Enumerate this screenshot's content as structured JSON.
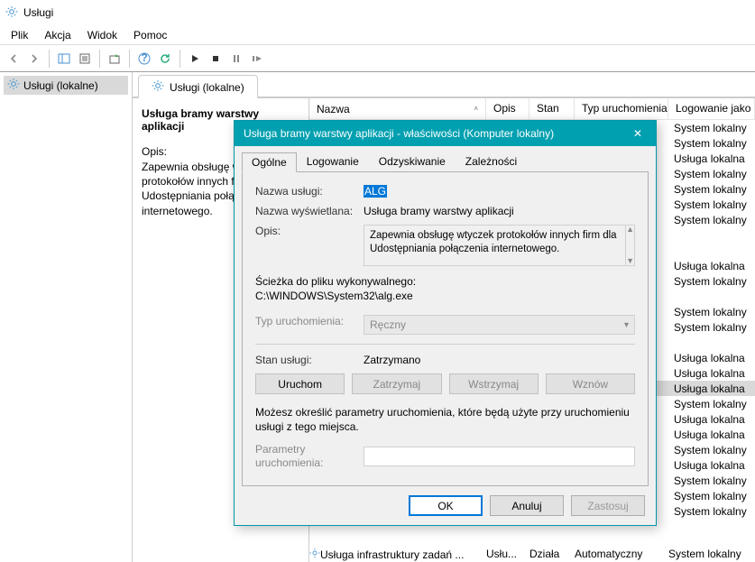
{
  "window": {
    "title": "Usługi"
  },
  "menu": {
    "file": "Plik",
    "action": "Akcja",
    "view": "Widok",
    "help": "Pomoc"
  },
  "tree": {
    "root": "Usługi (lokalne)"
  },
  "tab": {
    "label": "Usługi (lokalne)"
  },
  "detail": {
    "title": "Usługa bramy warstwy aplikacji",
    "opis_label": "Opis:",
    "opis_text": "Zapewnia obsługę wtyczek protokołów innych firm dla Udostępniania połączenia internetowego."
  },
  "columns": {
    "name": "Nazwa",
    "opis": "Opis",
    "stan": "Stan",
    "typ": "Typ uruchomienia",
    "log": "Logowanie jako"
  },
  "rows": {
    "status_dziala": "Działa",
    "log_system": "System lokalny",
    "log_usluga": "Usługa lokalna",
    "typ_auto": "Automatyczny",
    "ellipsis": "...",
    "footer_name": "Usługa infrastruktury zadań ...",
    "footer_opis": "Usłu...",
    "logs": [
      "System lokalny",
      "System lokalny",
      "Usługa lokalna",
      "System lokalny",
      "System lokalny",
      "System lokalny",
      "System lokalny",
      "",
      "",
      "Usługa lokalna",
      "System lokalny",
      "",
      "System lokalny",
      "System lokalny",
      "",
      "Usługa lokalna",
      "Usługa lokalna",
      "Usługa lokalna",
      "System lokalny",
      "Usługa lokalna",
      "Usługa lokalna",
      "System lokalny",
      "Usługa lokalna",
      "System lokalny",
      "System lokalny",
      "System lokalny"
    ],
    "selected_index": 17
  },
  "dialog": {
    "title": "Usługa bramy warstwy aplikacji - właściwości (Komputer lokalny)",
    "tabs": {
      "general": "Ogólne",
      "logon": "Logowanie",
      "recovery": "Odzyskiwanie",
      "deps": "Zależności"
    },
    "labels": {
      "service_name": "Nazwa usługi:",
      "display_name": "Nazwa wyświetlana:",
      "description": "Opis:",
      "exe_path_label": "Ścieżka do pliku wykonywalnego:",
      "startup_type": "Typ uruchomienia:",
      "service_state": "Stan usługi:",
      "start_params": "Parametry uruchomienia:",
      "note": "Możesz określić parametry uruchomienia, które będą użyte przy uruchomieniu usługi z tego miejsca."
    },
    "values": {
      "service_name": "ALG",
      "display_name": "Usługa bramy warstwy aplikacji",
      "description": "Zapewnia obsługę wtyczek protokołów innych firm dla Udostępniania połączenia internetowego.",
      "exe_path": "C:\\WINDOWS\\System32\\alg.exe",
      "startup_type": "Ręczny",
      "service_state": "Zatrzymano"
    },
    "buttons": {
      "start": "Uruchom",
      "stop": "Zatrzymaj",
      "pause": "Wstrzymaj",
      "resume": "Wznów",
      "ok": "OK",
      "cancel": "Anuluj",
      "apply": "Zastosuj"
    }
  }
}
